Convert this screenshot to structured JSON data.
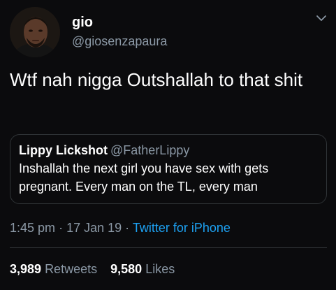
{
  "tweet": {
    "author": {
      "display_name": "gio",
      "handle": "@giosenzapaura"
    },
    "text": "Wtf nah nigga Outshallah to that shit",
    "quoted": {
      "display_name": "Lippy Lickshot",
      "handle": "@FatherLippy",
      "text": "Inshallah the next girl you have sex with gets pregnant. Every man on the TL, every man"
    },
    "time": "1:45 pm",
    "separator": "·",
    "date": "17 Jan 19",
    "source": "Twitter for iPhone",
    "retweets_count": "3,989",
    "retweets_label": "Retweets",
    "likes_count": "9,580",
    "likes_label": "Likes"
  },
  "colors": {
    "background": "#0b0b0d",
    "primary_text": "#ffffff",
    "secondary_text": "#8b98a5",
    "link": "#1da1f2",
    "border": "#2f3336"
  },
  "icons": {
    "avatar": "avatar-photo",
    "menu": "chevron-down-icon"
  }
}
